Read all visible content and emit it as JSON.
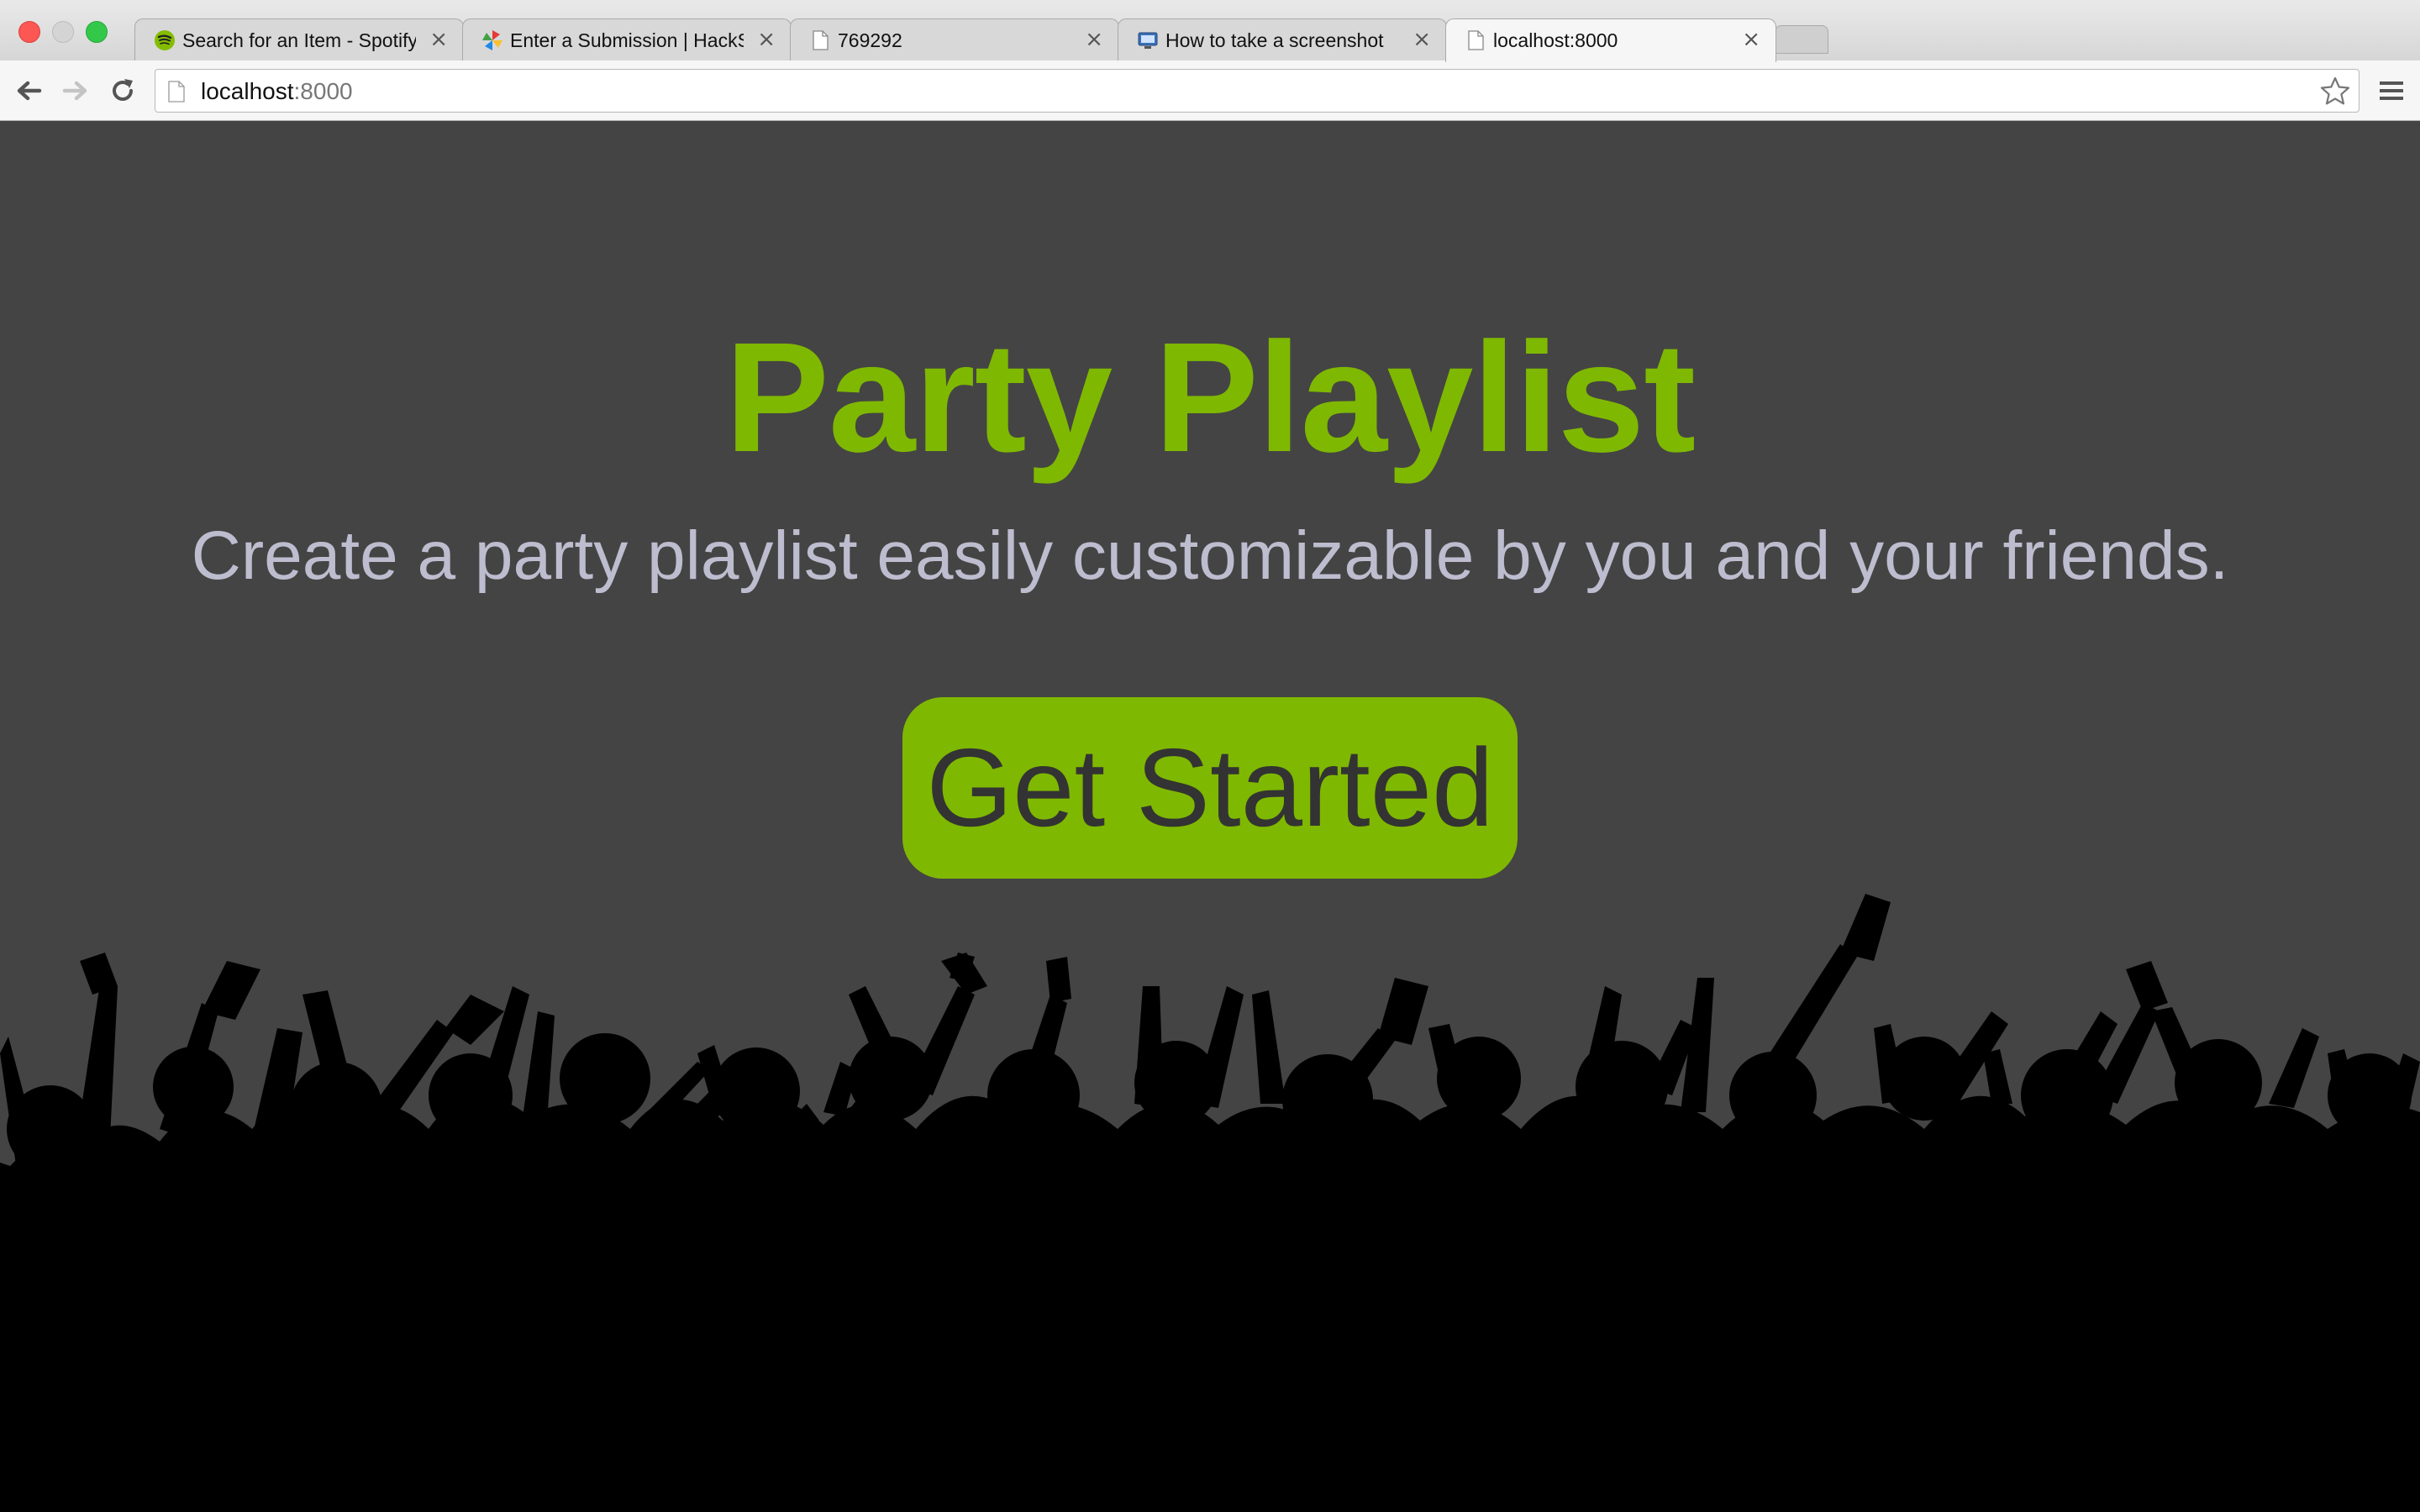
{
  "window": {
    "controls": [
      "close",
      "minimize",
      "maximize"
    ]
  },
  "tabs": [
    {
      "title": "Search for an Item - Spotify",
      "icon": "spotify-icon",
      "active": false
    },
    {
      "title": "Enter a Submission | HackS",
      "icon": "pinwheel-icon",
      "active": false
    },
    {
      "title": "769292",
      "icon": "page-icon",
      "active": false
    },
    {
      "title": "How to take a screenshot",
      "icon": "screenshot-site-icon",
      "active": false
    },
    {
      "title": "localhost:8000",
      "icon": "page-icon",
      "active": true
    }
  ],
  "toolbar": {
    "url_host": "localhost",
    "url_port": ":8000"
  },
  "page": {
    "title": "Party Playlist",
    "subtitle": "Create a party playlist easily customizable by you and your friends.",
    "cta_label": "Get Started"
  },
  "colors": {
    "background": "#444444",
    "accent_green": "#7fb800",
    "subtitle": "#bdbdcf",
    "button_text": "#333333",
    "crowd": "#000000"
  }
}
